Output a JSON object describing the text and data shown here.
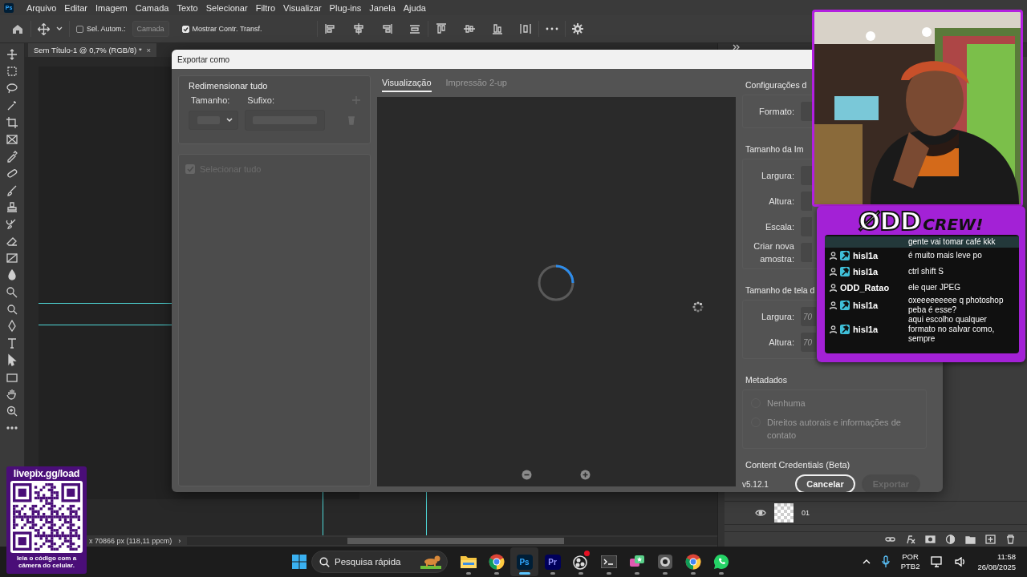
{
  "menubar": {
    "app_badge": "Ps",
    "menus": [
      "Arquivo",
      "Editar",
      "Imagem",
      "Camada",
      "Texto",
      "Selecionar",
      "Filtro",
      "Visualizar",
      "Plug-ins",
      "Janela",
      "Ajuda"
    ]
  },
  "options_bar": {
    "auto_select": {
      "label": "Sel. Autom.:",
      "checked": false
    },
    "target": {
      "value": "Camada",
      "disabled": true
    },
    "show_transform": {
      "label": "Mostrar Contr. Transf.",
      "checked": true
    }
  },
  "document_tab": {
    "title": "Sem Título-1 @ 0,7% (RGB/8) *",
    "close": "×"
  },
  "status_bar": {
    "size": "x 70866 px (118,11 ppcm)",
    "arrow": "›"
  },
  "layers": [
    {
      "name": "01",
      "visible": true
    }
  ],
  "dialog": {
    "title": "Exportar como",
    "resize_all": {
      "title": "Redimensionar tudo",
      "size_label": "Tamanho:",
      "suffix_label": "Sufixo:"
    },
    "select_all": {
      "label": "Selecionar tudo",
      "checked": true,
      "disabled": true
    },
    "tabs": [
      {
        "label": "Visualização",
        "selected": true
      },
      {
        "label": "Impressão 2-up",
        "selected": false
      }
    ],
    "settings": [
      {
        "title": "Configurações d",
        "fields": [
          {
            "label": "Formato:"
          }
        ]
      },
      {
        "title": "Tamanho da Im",
        "fields": [
          {
            "label": "Largura:"
          },
          {
            "label": "Altura:"
          },
          {
            "label": "Escala:"
          },
          {
            "label": "Criar nova amostra:"
          }
        ]
      },
      {
        "title": "Tamanho de tela d",
        "fields": [
          {
            "label": "Largura:",
            "value": "70"
          },
          {
            "label": "Altura:",
            "value": "70"
          }
        ]
      }
    ],
    "metadata": {
      "title": "Metadados",
      "options": [
        {
          "label": "Nenhuma",
          "selected": false
        },
        {
          "label": "Direitos autorais e informações de contato",
          "selected": false
        }
      ]
    },
    "content_credentials": "Content Credentials (Beta)",
    "version": "v5.12.1",
    "buttons": [
      {
        "label": "Cancelar",
        "disabled": false
      },
      {
        "label": "Exportar",
        "disabled": true
      }
    ]
  },
  "chat": {
    "logo": {
      "word": "ØDD",
      "tag": "CREW!"
    },
    "messages": [
      {
        "text": "gente vai tomar café kkk"
      },
      {
        "user": "hisl1a",
        "moderator": true,
        "text": "é muito mais leve po"
      },
      {
        "user": "hisl1a",
        "moderator": true,
        "text": "ctrl shift S"
      },
      {
        "user": "ODD_Ratao",
        "moderator": false,
        "text": "ele quer JPEG"
      },
      {
        "user": "hisl1a",
        "moderator": true,
        "text": "oxeeeeeeeee q photoshop peba é esse?"
      },
      {
        "user": "hisl1a",
        "moderator": true,
        "text": "aqui escolho qualquer formato no salvar como, sempre"
      }
    ]
  },
  "qr": {
    "url": "livepix.gg/load",
    "caption": "leia o código com a câmera do celular."
  },
  "taskbar": {
    "search_placeholder": "Pesquisa rápida",
    "apps": [
      {
        "kind": "explorer",
        "selected": false,
        "notification": false
      },
      {
        "kind": "chrome",
        "selected": false,
        "notification": false
      },
      {
        "kind": "photoshop",
        "label": "Ps",
        "selected": true,
        "notification": false
      },
      {
        "kind": "premiere",
        "label": "Pr",
        "selected": false,
        "notification": false
      },
      {
        "kind": "obs",
        "selected": false,
        "notification": true
      },
      {
        "kind": "terminal",
        "selected": false,
        "notification": false
      },
      {
        "kind": "chat",
        "selected": false,
        "notification": false
      },
      {
        "kind": "camera",
        "selected": false,
        "notification": false
      },
      {
        "kind": "chrome",
        "selected": false,
        "notification": false
      },
      {
        "kind": "whatsapp",
        "selected": false,
        "notification": false
      }
    ],
    "language": [
      "POR",
      "PTB2"
    ],
    "time": "11:58",
    "date": "26/08/2025"
  }
}
